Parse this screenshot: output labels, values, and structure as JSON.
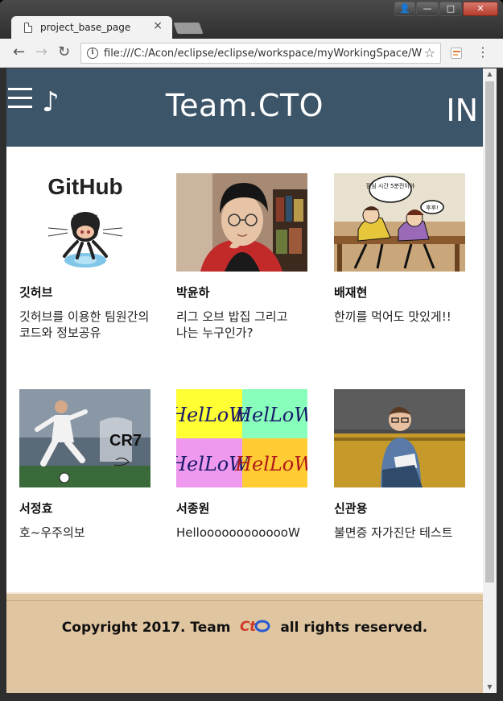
{
  "browser": {
    "tab_title": "project_base_page",
    "tab_close": "×",
    "url": "file:///C:/Acon/eclipse/eclipse/workspace/myWorkingSpace/W",
    "back": "←",
    "forward": "→",
    "reload": "↻",
    "star": "☆",
    "menu": "⋮",
    "info": "i",
    "window_buttons": {
      "user": "👤",
      "minimize": "—",
      "maximize": "□",
      "close": "✕"
    }
  },
  "header": {
    "title": "Team.CTO",
    "login": "IN",
    "note": "♪",
    "bg_color": "#3d5569"
  },
  "cards": [
    {
      "name": "깃허브",
      "desc": "깃허브를 이용한 팀원간의 코드와 정보공유",
      "image": "github-logo"
    },
    {
      "name": "박윤하",
      "desc": "리그 오브 밥집 그리고 나는 누구인가?",
      "image": "portrait-photo"
    },
    {
      "name": "배재현",
      "desc": "한끼를 먹어도 맛있게!!",
      "image": "comic-panel",
      "comic_top": "점심 시간 5분전이야",
      "comic_bubble": "후후!"
    },
    {
      "name": "서정효",
      "desc": "호~우주의보",
      "image": "soccer-poster",
      "poster_text": "CR7"
    },
    {
      "name": "서종원",
      "desc": "HellooooooooooooW",
      "image": "hello-tiles",
      "tile_text": "HelLoW"
    },
    {
      "name": "신관용",
      "desc": "불면증 자가진단 테스트",
      "image": "man-on-sofa"
    }
  ],
  "footer": {
    "prefix": "Copyright 2017. Team",
    "suffix": "all rights reserved.",
    "logo_text": "CtO",
    "bg_color": "#dfc6a0"
  }
}
